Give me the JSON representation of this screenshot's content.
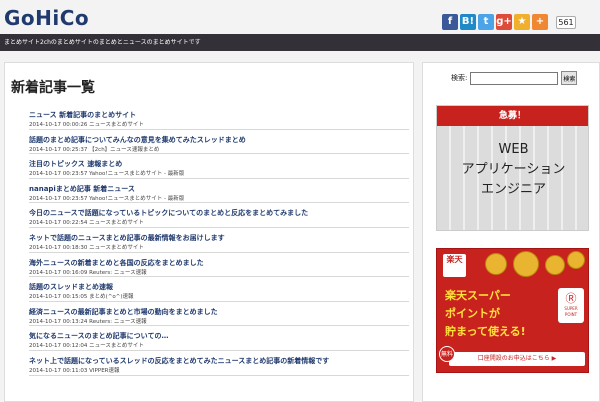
{
  "site": {
    "logo": "GoHiCo",
    "tagline": "まとめサイト2chのまとめサイトのまとめとニュースのまとめサイトです"
  },
  "share": {
    "buttons": [
      {
        "name": "facebook-icon",
        "glyph": "f",
        "color": "#3b5998"
      },
      {
        "name": "hatena-icon",
        "glyph": "B!",
        "color": "#1f8ac7"
      },
      {
        "name": "twitter-icon",
        "glyph": "t",
        "color": "#4ba3e8"
      },
      {
        "name": "google-plus-icon",
        "glyph": "g+",
        "color": "#dd4b39"
      },
      {
        "name": "star-icon",
        "glyph": "★",
        "color": "#f0b02e"
      },
      {
        "name": "plus-icon",
        "glyph": "+",
        "color": "#f08732"
      }
    ],
    "count": "561"
  },
  "main": {
    "title": "新着記事一覧",
    "articles": [
      {
        "title": "ニュース 新着記事のまとめサイト",
        "date": "2014-10-17 00:00:26",
        "source": "ニュースまとめサイト"
      },
      {
        "title": "話題のまとめ記事についてみんなの意見を集めてみたスレッドまとめ",
        "date": "2014-10-17 00:25:37",
        "source": "【2ch】ニュース速報まとめ"
      },
      {
        "title": "注目のトピックス 速報まとめ",
        "date": "2014-10-17 00:23:57",
        "source": "Yahoo!ニュースまとめサイト - 最新版"
      },
      {
        "title": "nanapiまとめ記事 新着ニュース",
        "date": "2014-10-17 00:23:57",
        "source": "Yahoo!ニュースまとめサイト - 最新版"
      },
      {
        "title": "今日のニュースで話題になっているトピックについてのまとめと反応をまとめてみました",
        "date": "2014-10-17 00:22:54",
        "source": "ニュースまとめサイト"
      },
      {
        "title": "ネットで話題のニュースまとめ記事の最新情報をお届けします",
        "date": "2014-10-17 00:18:30",
        "source": "ニュースまとめサイト"
      },
      {
        "title": "海外ニュースの新着まとめと各国の反応をまとめました",
        "date": "2014-10-17 00:16:09",
        "source": "Reuters: ニュース速報"
      },
      {
        "title": "話題のスレッドまとめ速報",
        "date": "2014-10-17 00:15:05",
        "source": "まとめ(^o^)速報"
      },
      {
        "title": "経済ニュースの最新記事まとめと市場の動向をまとめました",
        "date": "2014-10-17 00:13:24",
        "source": "Reuters: ニュース速報"
      },
      {
        "title": "気になるニュースのまとめ記事についての…",
        "date": "2014-10-17 00:12:04",
        "source": "ニュースまとめサイト"
      },
      {
        "title": "ネット上で話題になっているスレッドの反応をまとめてみたニュースまとめ記事の新着情報です",
        "date": "2014-10-17 00:11:03",
        "source": "VIPPER速報"
      }
    ]
  },
  "sidebar": {
    "search": {
      "label": "検索:",
      "button": "検索"
    },
    "ad1": {
      "banner": "急募！",
      "line1": "WEB",
      "line2": "アプリケーション",
      "line3": "エンジニア"
    },
    "ad2": {
      "logo": "楽天",
      "line1": "楽天スーパー",
      "line2": "ポイントが",
      "line3": "貯まって使える!",
      "badge": "SUPER POINT",
      "free": "無料",
      "cta": "口座開設のお申込はこちら ▶"
    }
  }
}
